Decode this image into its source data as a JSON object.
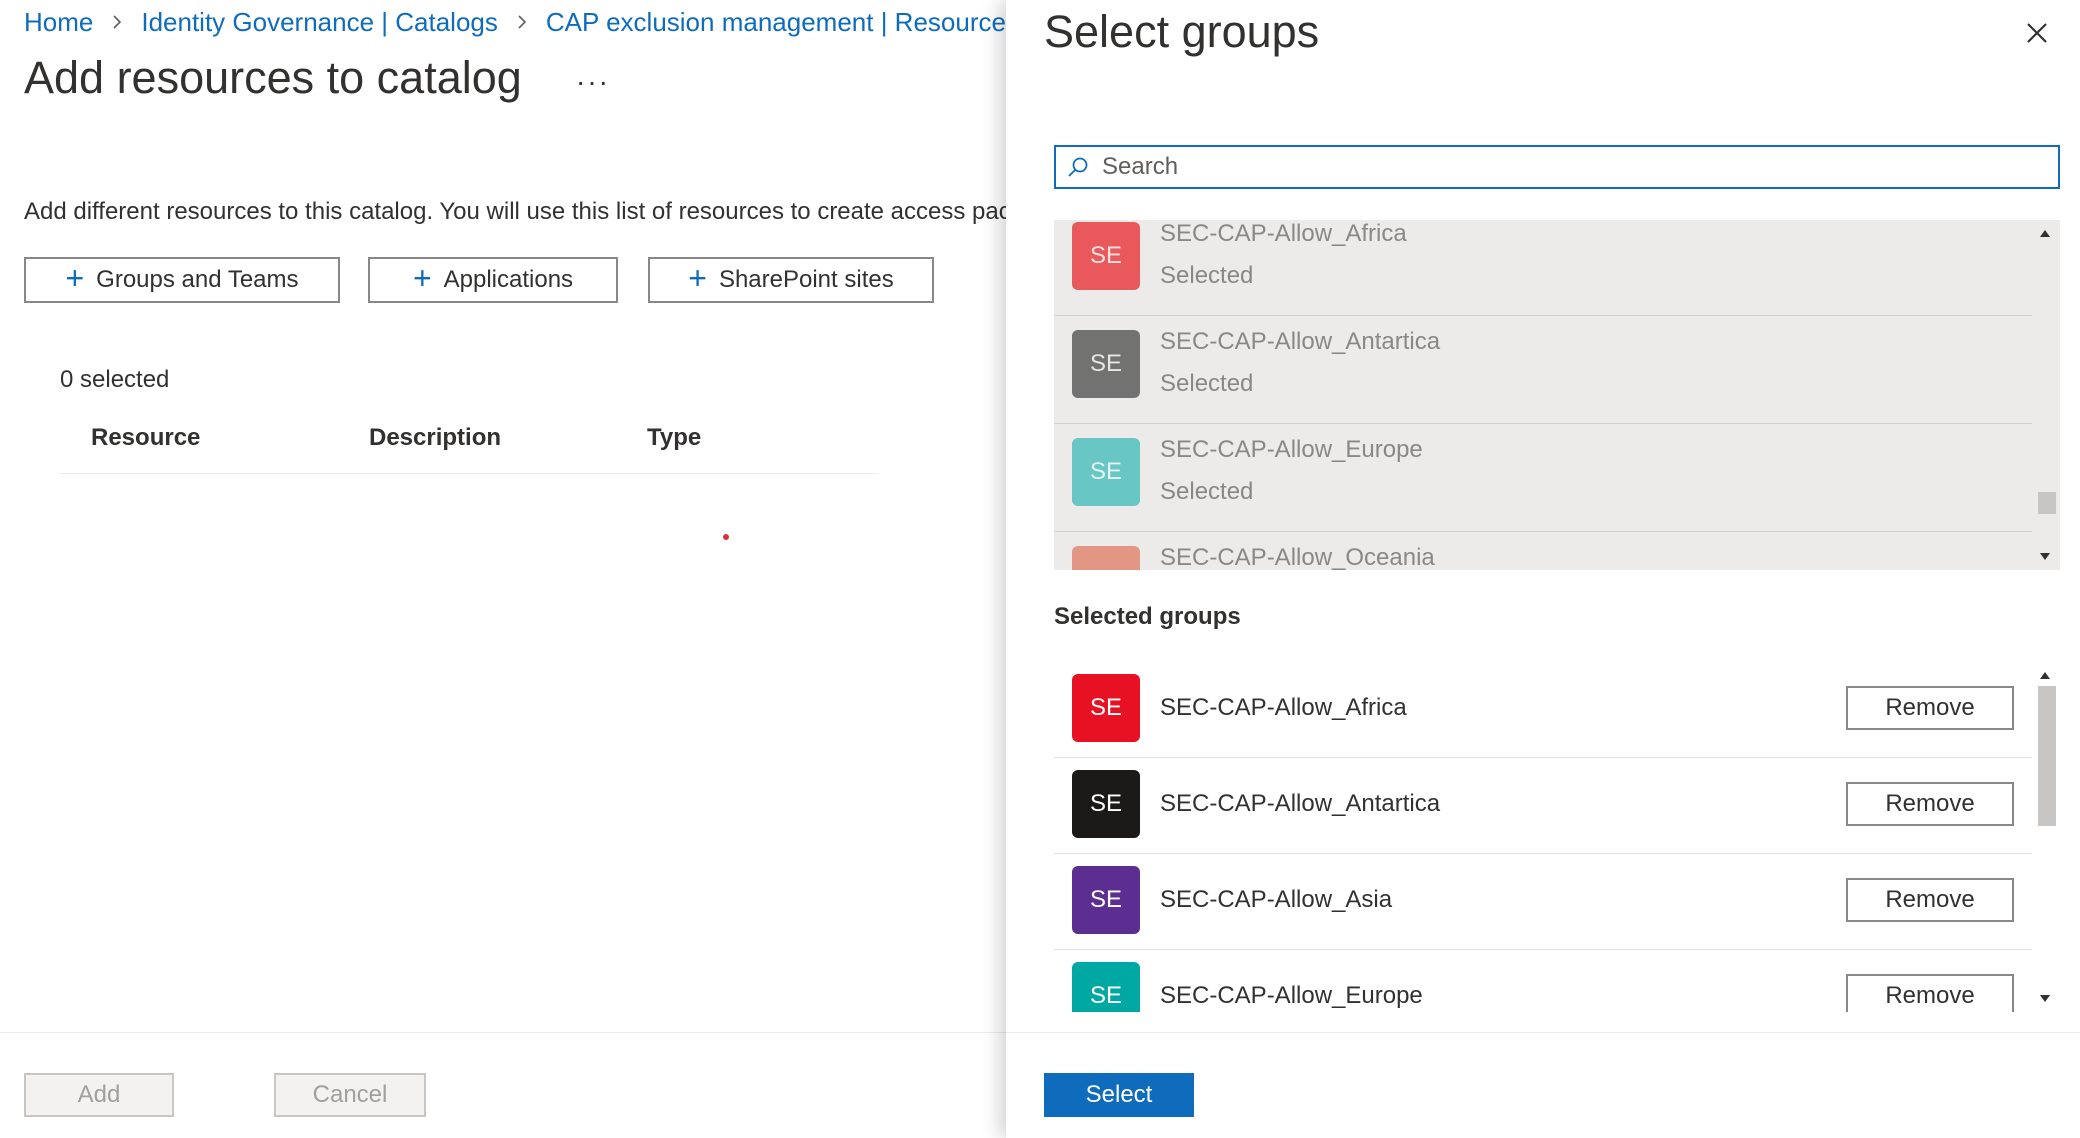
{
  "breadcrumb": [
    {
      "label": "Home"
    },
    {
      "label": "Identity Governance | Catalogs"
    },
    {
      "label": "CAP exclusion management | Resources"
    }
  ],
  "page": {
    "title": "Add resources to catalog",
    "more_label": "···",
    "description": "Add different resources to this catalog. You will use this list of resources to create access pac",
    "buttons": {
      "groups_teams": "Groups and Teams",
      "applications": "Applications",
      "sharepoint": "SharePoint sites",
      "plus_icon": "plus-icon"
    },
    "selected_count": "0 selected",
    "columns": [
      "Resource",
      "Description",
      "Type"
    ],
    "footer": {
      "add": "Add",
      "cancel": "Cancel"
    }
  },
  "panel": {
    "title": "Select groups",
    "close_icon": "close-icon",
    "search": {
      "placeholder": "Search",
      "value": ""
    },
    "results": [
      {
        "initials": "SE",
        "name": "SEC-CAP-Allow_Africa",
        "status": "Selected",
        "color": "#e8282b"
      },
      {
        "initials": "SE",
        "name": "SEC-CAP-Allow_Antartica",
        "status": "Selected",
        "color": "#4a4a4a"
      },
      {
        "initials": "SE",
        "name": "SEC-CAP-Allow_Europe",
        "status": "Selected",
        "color": "#3cbcb8"
      },
      {
        "initials": "SE",
        "name": "SEC-CAP-Allow_Oceania",
        "status": "",
        "color": "#e07a62"
      }
    ],
    "selected_title": "Selected groups",
    "selected": [
      {
        "initials": "SE",
        "name": "SEC-CAP-Allow_Africa",
        "color": "#e81123",
        "remove": "Remove"
      },
      {
        "initials": "SE",
        "name": "SEC-CAP-Allow_Antartica",
        "color": "#1b1a19",
        "remove": "Remove"
      },
      {
        "initials": "SE",
        "name": "SEC-CAP-Allow_Asia",
        "color": "#5c2e91",
        "remove": "Remove"
      },
      {
        "initials": "SE",
        "name": "SEC-CAP-Allow_Europe",
        "color": "#00a8a4",
        "remove": "Remove"
      }
    ],
    "select_button": "Select"
  },
  "colors": {
    "accent": "#0f6cbd"
  }
}
